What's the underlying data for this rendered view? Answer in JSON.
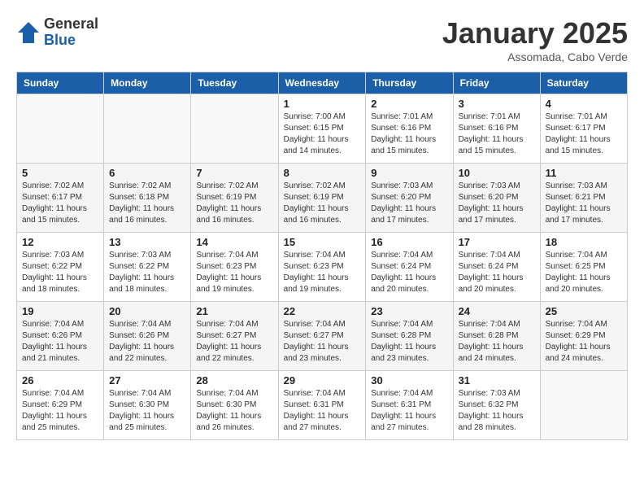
{
  "logo": {
    "general": "General",
    "blue": "Blue"
  },
  "header": {
    "month": "January 2025",
    "location": "Assomada, Cabo Verde"
  },
  "weekdays": [
    "Sunday",
    "Monday",
    "Tuesday",
    "Wednesday",
    "Thursday",
    "Friday",
    "Saturday"
  ],
  "weeks": [
    [
      {
        "day": "",
        "sunrise": "",
        "sunset": "",
        "daylight": ""
      },
      {
        "day": "",
        "sunrise": "",
        "sunset": "",
        "daylight": ""
      },
      {
        "day": "",
        "sunrise": "",
        "sunset": "",
        "daylight": ""
      },
      {
        "day": "1",
        "sunrise": "Sunrise: 7:00 AM",
        "sunset": "Sunset: 6:15 PM",
        "daylight": "Daylight: 11 hours and 14 minutes."
      },
      {
        "day": "2",
        "sunrise": "Sunrise: 7:01 AM",
        "sunset": "Sunset: 6:16 PM",
        "daylight": "Daylight: 11 hours and 15 minutes."
      },
      {
        "day": "3",
        "sunrise": "Sunrise: 7:01 AM",
        "sunset": "Sunset: 6:16 PM",
        "daylight": "Daylight: 11 hours and 15 minutes."
      },
      {
        "day": "4",
        "sunrise": "Sunrise: 7:01 AM",
        "sunset": "Sunset: 6:17 PM",
        "daylight": "Daylight: 11 hours and 15 minutes."
      }
    ],
    [
      {
        "day": "5",
        "sunrise": "Sunrise: 7:02 AM",
        "sunset": "Sunset: 6:17 PM",
        "daylight": "Daylight: 11 hours and 15 minutes."
      },
      {
        "day": "6",
        "sunrise": "Sunrise: 7:02 AM",
        "sunset": "Sunset: 6:18 PM",
        "daylight": "Daylight: 11 hours and 16 minutes."
      },
      {
        "day": "7",
        "sunrise": "Sunrise: 7:02 AM",
        "sunset": "Sunset: 6:19 PM",
        "daylight": "Daylight: 11 hours and 16 minutes."
      },
      {
        "day": "8",
        "sunrise": "Sunrise: 7:02 AM",
        "sunset": "Sunset: 6:19 PM",
        "daylight": "Daylight: 11 hours and 16 minutes."
      },
      {
        "day": "9",
        "sunrise": "Sunrise: 7:03 AM",
        "sunset": "Sunset: 6:20 PM",
        "daylight": "Daylight: 11 hours and 17 minutes."
      },
      {
        "day": "10",
        "sunrise": "Sunrise: 7:03 AM",
        "sunset": "Sunset: 6:20 PM",
        "daylight": "Daylight: 11 hours and 17 minutes."
      },
      {
        "day": "11",
        "sunrise": "Sunrise: 7:03 AM",
        "sunset": "Sunset: 6:21 PM",
        "daylight": "Daylight: 11 hours and 17 minutes."
      }
    ],
    [
      {
        "day": "12",
        "sunrise": "Sunrise: 7:03 AM",
        "sunset": "Sunset: 6:22 PM",
        "daylight": "Daylight: 11 hours and 18 minutes."
      },
      {
        "day": "13",
        "sunrise": "Sunrise: 7:03 AM",
        "sunset": "Sunset: 6:22 PM",
        "daylight": "Daylight: 11 hours and 18 minutes."
      },
      {
        "day": "14",
        "sunrise": "Sunrise: 7:04 AM",
        "sunset": "Sunset: 6:23 PM",
        "daylight": "Daylight: 11 hours and 19 minutes."
      },
      {
        "day": "15",
        "sunrise": "Sunrise: 7:04 AM",
        "sunset": "Sunset: 6:23 PM",
        "daylight": "Daylight: 11 hours and 19 minutes."
      },
      {
        "day": "16",
        "sunrise": "Sunrise: 7:04 AM",
        "sunset": "Sunset: 6:24 PM",
        "daylight": "Daylight: 11 hours and 20 minutes."
      },
      {
        "day": "17",
        "sunrise": "Sunrise: 7:04 AM",
        "sunset": "Sunset: 6:24 PM",
        "daylight": "Daylight: 11 hours and 20 minutes."
      },
      {
        "day": "18",
        "sunrise": "Sunrise: 7:04 AM",
        "sunset": "Sunset: 6:25 PM",
        "daylight": "Daylight: 11 hours and 20 minutes."
      }
    ],
    [
      {
        "day": "19",
        "sunrise": "Sunrise: 7:04 AM",
        "sunset": "Sunset: 6:26 PM",
        "daylight": "Daylight: 11 hours and 21 minutes."
      },
      {
        "day": "20",
        "sunrise": "Sunrise: 7:04 AM",
        "sunset": "Sunset: 6:26 PM",
        "daylight": "Daylight: 11 hours and 22 minutes."
      },
      {
        "day": "21",
        "sunrise": "Sunrise: 7:04 AM",
        "sunset": "Sunset: 6:27 PM",
        "daylight": "Daylight: 11 hours and 22 minutes."
      },
      {
        "day": "22",
        "sunrise": "Sunrise: 7:04 AM",
        "sunset": "Sunset: 6:27 PM",
        "daylight": "Daylight: 11 hours and 23 minutes."
      },
      {
        "day": "23",
        "sunrise": "Sunrise: 7:04 AM",
        "sunset": "Sunset: 6:28 PM",
        "daylight": "Daylight: 11 hours and 23 minutes."
      },
      {
        "day": "24",
        "sunrise": "Sunrise: 7:04 AM",
        "sunset": "Sunset: 6:28 PM",
        "daylight": "Daylight: 11 hours and 24 minutes."
      },
      {
        "day": "25",
        "sunrise": "Sunrise: 7:04 AM",
        "sunset": "Sunset: 6:29 PM",
        "daylight": "Daylight: 11 hours and 24 minutes."
      }
    ],
    [
      {
        "day": "26",
        "sunrise": "Sunrise: 7:04 AM",
        "sunset": "Sunset: 6:29 PM",
        "daylight": "Daylight: 11 hours and 25 minutes."
      },
      {
        "day": "27",
        "sunrise": "Sunrise: 7:04 AM",
        "sunset": "Sunset: 6:30 PM",
        "daylight": "Daylight: 11 hours and 25 minutes."
      },
      {
        "day": "28",
        "sunrise": "Sunrise: 7:04 AM",
        "sunset": "Sunset: 6:30 PM",
        "daylight": "Daylight: 11 hours and 26 minutes."
      },
      {
        "day": "29",
        "sunrise": "Sunrise: 7:04 AM",
        "sunset": "Sunset: 6:31 PM",
        "daylight": "Daylight: 11 hours and 27 minutes."
      },
      {
        "day": "30",
        "sunrise": "Sunrise: 7:04 AM",
        "sunset": "Sunset: 6:31 PM",
        "daylight": "Daylight: 11 hours and 27 minutes."
      },
      {
        "day": "31",
        "sunrise": "Sunrise: 7:03 AM",
        "sunset": "Sunset: 6:32 PM",
        "daylight": "Daylight: 11 hours and 28 minutes."
      },
      {
        "day": "",
        "sunrise": "",
        "sunset": "",
        "daylight": ""
      }
    ]
  ]
}
